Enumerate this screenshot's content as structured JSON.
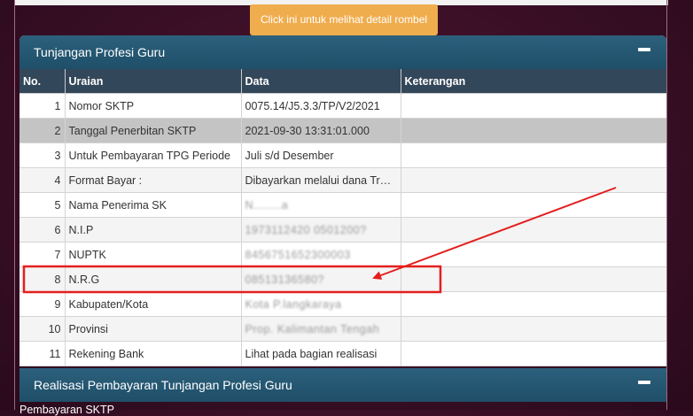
{
  "rombel_button": "Click ini untuk melihat detail rombel",
  "panel": {
    "title": "Tunjangan Profesi Guru",
    "columns": [
      "No.",
      "Uraian",
      "Data",
      "Keterangan"
    ],
    "rows": [
      {
        "no": "1",
        "uraian": "Nomor SKTP",
        "data": "0075.14/J5.3.3/TP/V2/2021",
        "keterangan": ""
      },
      {
        "no": "2",
        "uraian": "Tanggal Penerbitan SKTP",
        "data": "2021-09-30 13:31:01.000",
        "keterangan": ""
      },
      {
        "no": "3",
        "uraian": "Untuk Pembayaran TPG Periode",
        "data": "Juli s/d Desember",
        "keterangan": ""
      },
      {
        "no": "4",
        "uraian": "Format Bayar :",
        "data": "Dibayarkan melalui dana Transf...",
        "keterangan": ""
      },
      {
        "no": "5",
        "uraian": "Nama Penerima SK",
        "data": "N........a",
        "keterangan": ""
      },
      {
        "no": "6",
        "uraian": "N.I.P",
        "data": "1973112420 0501200?",
        "keterangan": ""
      },
      {
        "no": "7",
        "uraian": "NUPTK",
        "data": "8456751652300003",
        "keterangan": ""
      },
      {
        "no": "8",
        "uraian": "N.R.G",
        "data": "08513136580?",
        "keterangan": ""
      },
      {
        "no": "9",
        "uraian": "Kabupaten/Kota",
        "data": "Kota P.langkaraya",
        "keterangan": ""
      },
      {
        "no": "10",
        "uraian": "Provinsi",
        "data": "Prop. Kalimantan Tengah",
        "keterangan": ""
      },
      {
        "no": "11",
        "uraian": "Rekening Bank",
        "data": "Lihat pada bagian realisasi",
        "keterangan": ""
      }
    ]
  },
  "panel2": {
    "title": "Realisasi Pembayaran Tunjangan Profesi Guru"
  },
  "cut_text": "Pembayaran SKTP",
  "colors": {
    "header": "#1f4f69",
    "table_head": "#33475a",
    "button": "#f0ad4e",
    "annotation": "#e41e1e"
  }
}
